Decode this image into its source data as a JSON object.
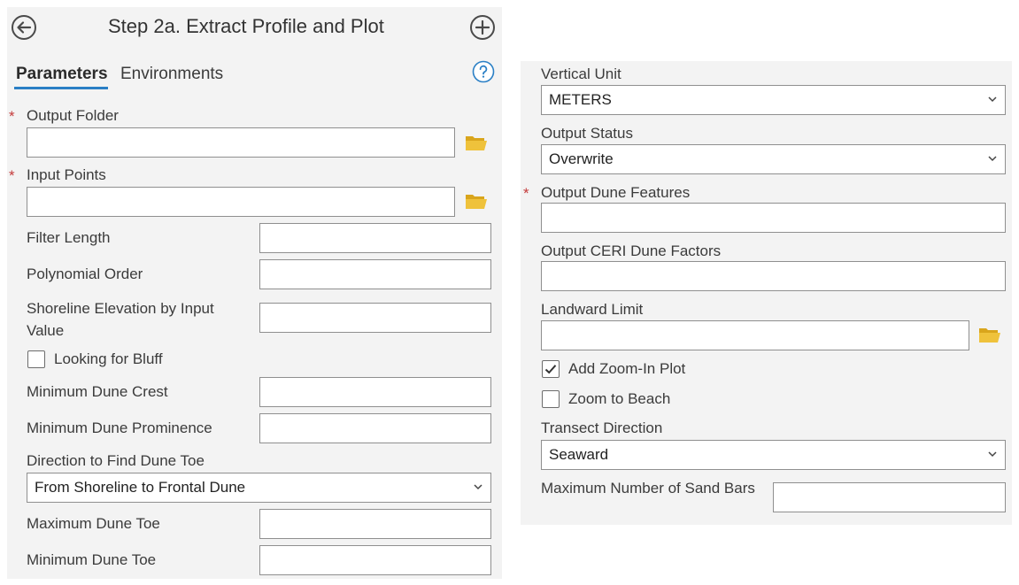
{
  "header": {
    "title": "Step 2a. Extract Profile and Plot",
    "back_icon": "back-arrow-circle-icon",
    "add_icon": "plus-circle-icon"
  },
  "tabs": [
    {
      "label": "Parameters",
      "active": true
    },
    {
      "label": "Environments",
      "active": false
    }
  ],
  "help_icon": "help-icon",
  "required_marker": "*",
  "colors": {
    "accent": "#2a7fc5",
    "required": "#c43b3b",
    "folder": "#e8b923",
    "panel_bg": "#f3f3f3"
  },
  "left": {
    "output_folder": {
      "label": "Output Folder",
      "value": "",
      "required": true
    },
    "input_points": {
      "label": "Input Points",
      "value": "",
      "required": true
    },
    "filter_length": {
      "label": "Filter Length",
      "value": ""
    },
    "polynomial_order": {
      "label": "Polynomial Order",
      "value": ""
    },
    "shoreline_elevation": {
      "label": "Shoreline Elevation by Input Value",
      "value": ""
    },
    "looking_for_bluff": {
      "label": "Looking for Bluff",
      "checked": false
    },
    "min_dune_crest": {
      "label": "Minimum Dune Crest",
      "value": ""
    },
    "min_dune_prominence": {
      "label": "Minimum Dune Prominence",
      "value": ""
    },
    "direction_dune_toe": {
      "label": "Direction to Find Dune Toe",
      "value": "From Shoreline to Frontal Dune"
    },
    "max_dune_toe": {
      "label": "Maximum Dune Toe",
      "value": ""
    },
    "min_dune_toe": {
      "label": "Minimum Dune Toe",
      "value": ""
    }
  },
  "right": {
    "vertical_unit": {
      "label": "Vertical Unit",
      "value": "METERS"
    },
    "output_status": {
      "label": "Output Status",
      "value": "Overwrite"
    },
    "output_dune_features": {
      "label": "Output Dune Features",
      "value": "",
      "required": true
    },
    "output_ceri": {
      "label": "Output CERI Dune Factors",
      "value": ""
    },
    "landward_limit": {
      "label": "Landward Limit",
      "value": ""
    },
    "add_zoom_in_plot": {
      "label": "Add Zoom-In Plot",
      "checked": true
    },
    "zoom_to_beach": {
      "label": "Zoom to Beach",
      "checked": false
    },
    "transect_direction": {
      "label": "Transect Direction",
      "value": "Seaward"
    },
    "max_sand_bars": {
      "label": "Maximum Number of Sand Bars",
      "value": ""
    }
  }
}
